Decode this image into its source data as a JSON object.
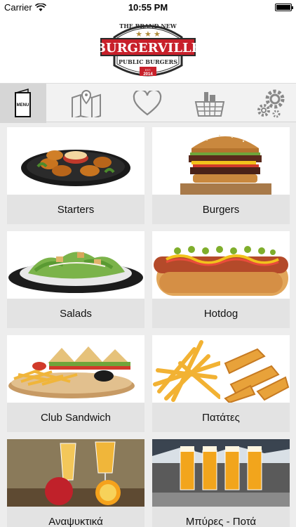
{
  "status": {
    "carrier": "Carrier",
    "time": "10:55 PM"
  },
  "logo": {
    "top_text": "THE BRAND NEW",
    "brand": "BURGERVILLE",
    "bottom_text": "PUBLIC BURGERS",
    "est": "EST.",
    "year": "2014",
    "colors": {
      "red": "#c8202a",
      "dark": "#2b2b2b",
      "gold": "#b08c3c"
    }
  },
  "toolbar": {
    "items": [
      {
        "icon": "menu-card-icon",
        "label": "MENU"
      },
      {
        "icon": "map-icon"
      },
      {
        "icon": "heart-icon"
      },
      {
        "icon": "basket-icon"
      },
      {
        "icon": "gears-icon"
      }
    ]
  },
  "categories": [
    {
      "label": "Starters",
      "image": "chicken-nuggets-plate"
    },
    {
      "label": "Burgers",
      "image": "burger"
    },
    {
      "label": "Salads",
      "image": "salad-plate"
    },
    {
      "label": "Hotdog",
      "image": "hotdog"
    },
    {
      "label": "Club Sandwich",
      "image": "club-sandwich-with-fries"
    },
    {
      "label": "Πατάτες",
      "image": "fries"
    },
    {
      "label": "Αναψυκτικά",
      "image": "juice-and-fruit"
    },
    {
      "label": "Μπύρες - Ποτά",
      "image": "beer-glasses"
    }
  ]
}
